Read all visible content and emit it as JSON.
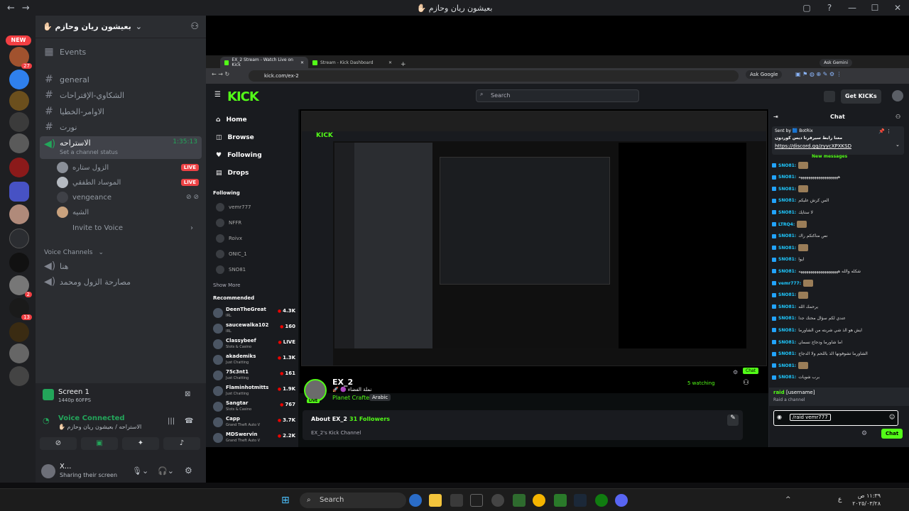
{
  "window": {
    "title": "بعيشون ريان وحازم ✋🏻",
    "nav_back": "←",
    "nav_forward": "→",
    "controls": [
      "▢",
      "?",
      "—",
      "☐",
      "✕"
    ]
  },
  "rail": {
    "new_label": "NEW",
    "badges": [
      "27",
      "2",
      "13"
    ]
  },
  "server": {
    "name": "بعيشون ريان وحازم ✋🏻",
    "events_label": "Events",
    "channels": [
      {
        "name": "general"
      },
      {
        "name": "الشكاوي-الإقتراحات"
      },
      {
        "name": "الاوامر-الخطيا"
      },
      {
        "name": "نورت"
      }
    ],
    "voice_channel": {
      "name": "الاستراحه",
      "status": "Set a channel status",
      "time": "1:35:13",
      "users": [
        {
          "name": "الزول ستاره",
          "live": "LIVE"
        },
        {
          "name": "الموساد الطفقي",
          "live": "LIVE"
        },
        {
          "name": "vengeance",
          "live": ""
        },
        {
          "name": "الشيه",
          "live": ""
        }
      ],
      "invite": "Invite to Voice"
    },
    "voice_section": "Voice Channels",
    "voice_others": [
      "هنا",
      "مصارحة الزول ومحمد"
    ]
  },
  "stream_panel": {
    "title": "Screen 1",
    "quality": "1440p 60FPS",
    "connected": "Voice Connected",
    "sub": "الاستراحه / بعيشون ريان وحازم ✋🏻"
  },
  "user": {
    "name": "X...",
    "status": "Sharing their screen"
  },
  "browser": {
    "tabs": [
      {
        "label": "EX_2 Stream - Watch Live on Kick"
      },
      {
        "label": "Stream - Kick Dashboard"
      }
    ],
    "new_tab": "+",
    "ask_gemini": "Ask Gemini",
    "url": "kick.com/ex-2",
    "ask_google": "Ask Google"
  },
  "kick": {
    "logo": "KICK",
    "search_placeholder": "Search",
    "get_kicks": "Get KICKs",
    "nav": [
      "Home",
      "Browse",
      "Following",
      "Drops"
    ],
    "following_heading": "Following",
    "following": [
      "vemr777",
      "NFFR",
      "Roivx",
      "ONIC_1",
      "SNO81"
    ],
    "show_more": "Show More",
    "recommended_heading": "Recommended",
    "recommended": [
      {
        "name": "DeenTheGreat",
        "cat": "IRL",
        "viewers": "4.3K"
      },
      {
        "name": "saucewalka102",
        "cat": "IRL",
        "viewers": "160"
      },
      {
        "name": "Classybeef",
        "cat": "Slots & Casino",
        "viewers": "LIVE"
      },
      {
        "name": "akademiks",
        "cat": "Just Chatting",
        "viewers": "1.3K"
      },
      {
        "name": "75c3nt1",
        "cat": "Just Chatting",
        "viewers": "161"
      },
      {
        "name": "Flaminhotmitts",
        "cat": "Just Chatting",
        "viewers": "1.9K"
      },
      {
        "name": "Sangtar",
        "cat": "Slots & Casino",
        "viewers": "767"
      },
      {
        "name": "Capp",
        "cat": "Grand Theft Auto V",
        "viewers": "3.7K"
      },
      {
        "name": "MDSwervin",
        "cat": "Grand Theft Auto V",
        "viewers": "2.2K"
      }
    ],
    "channel": {
      "name": "EX_2",
      "tagline": "نملة الفضاء 🟣 🚀",
      "category": "Planet Crafter",
      "language": "Arabic",
      "live": "LIVE",
      "watching": "5 watching",
      "about": "About EX_2",
      "followers": "31 Followers",
      "desc": "EX_2's Kick Channel"
    },
    "chat": {
      "title": "Chat",
      "pinned_sender": "Sent by 🟦 BotRix",
      "pinned_text": "معنا رابط سيرفرنا ديس كوردون",
      "pinned_link": "https://discord.gg/zyycXPXKSD",
      "new_messages": "New messages",
      "messages": [
        {
          "user": "SNO81:",
          "text": "",
          "emote": true
        },
        {
          "user": "SNO81:",
          "text": "ههههههههههههههههههههه",
          "emote": false
        },
        {
          "user": "SNO81:",
          "text": "",
          "emote": true
        },
        {
          "user": "SNO81:",
          "text": "الس كرش عليكم",
          "emote": false
        },
        {
          "user": "SNO81:",
          "text": "لا ستايك",
          "emote": false
        },
        {
          "user": "LTRQ4:",
          "text": "",
          "emote": true
        },
        {
          "user": "SNO81:",
          "text": "نص مناكتكم راك",
          "emote": false
        },
        {
          "user": "SNO81:",
          "text": "",
          "emote": true
        },
        {
          "user": "SNO81:",
          "text": "ايوا",
          "emote": false
        },
        {
          "user": "SNO81:",
          "text": "شكله والله ههههههههههههههههههههه",
          "emote": false
        },
        {
          "user": "vemr777:",
          "text": "",
          "emote": true
        },
        {
          "user": "SNO81:",
          "text": "",
          "emote": true
        },
        {
          "user": "SNO81:",
          "text": "يرحمك الله",
          "emote": false
        },
        {
          "user": "SNO81:",
          "text": "عندي لكم سؤال محتك جدا",
          "emote": false
        },
        {
          "user": "SNO81:",
          "text": "ايش هو الذ شي شربته من الشاورما",
          "emote": false
        },
        {
          "user": "SNO81:",
          "text": "اما شاورما ودجاج نسمان",
          "emote": false
        },
        {
          "user": "SNO81:",
          "text": "الشاورما تشوفونها الذ باللحم ولا الدجاج",
          "emote": false
        },
        {
          "user": "SNO81:",
          "text": "",
          "emote": true
        },
        {
          "user": "SNO81:",
          "text": "برب شويات",
          "emote": false
        }
      ],
      "raid_cmd": "raid",
      "raid_arg": "[username]",
      "raid_desc": "Raid a channel",
      "input_value": "/raid vemr777",
      "send": "Chat"
    }
  },
  "taskbar": {
    "search": "Search",
    "time": "١١:٣٩ ص",
    "date": "٢٠٢٥/٠٣/٢٨",
    "lang": "ع"
  }
}
